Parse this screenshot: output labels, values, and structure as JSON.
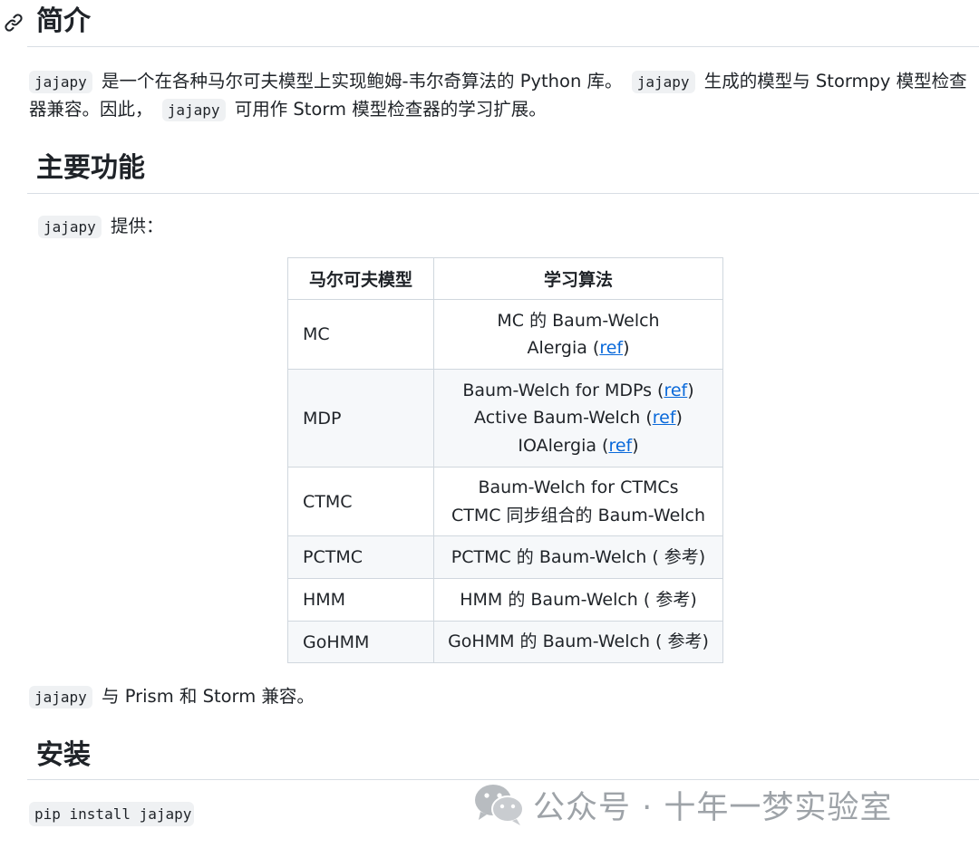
{
  "sections": {
    "intro_heading": "简介",
    "features_heading": "主要功能",
    "install_heading": "安装"
  },
  "intro": {
    "line1": {
      "code1": "jajapy",
      "text1": " 是一个在各种马尔可夫模型上实现鲍姆-韦尔奇算法的 Python 库。 ",
      "code2": "jajapy",
      "text2": " 生成的模型与 Stormpy 模型检查"
    },
    "line2": {
      "text1": "器兼容。因此， ",
      "code": "jajapy",
      "text2": " 可用作 Storm 模型检查器的学习扩展。"
    }
  },
  "provides": {
    "code": "jajapy",
    "text": " 提供："
  },
  "table": {
    "headers": [
      "马尔可夫模型",
      "学习算法"
    ],
    "rows": [
      {
        "model": "MC",
        "algos": [
          {
            "text": "MC 的 Baum-Welch",
            "ref": ""
          },
          {
            "text": "Alergia (",
            "ref": "ref",
            "after": ")"
          }
        ]
      },
      {
        "model": "MDP",
        "algos": [
          {
            "text": "Baum-Welch for MDPs (",
            "ref": "ref",
            "after": ")"
          },
          {
            "text": "Active Baum-Welch (",
            "ref": "ref",
            "after": ")"
          },
          {
            "text": "IOAlergia (",
            "ref": "ref",
            "after": ")"
          }
        ]
      },
      {
        "model": "CTMC",
        "algos": [
          {
            "text": "Baum-Welch for CTMCs",
            "ref": ""
          },
          {
            "text": "CTMC 同步组合的 Baum-Welch",
            "ref": ""
          }
        ]
      },
      {
        "model": "PCTMC",
        "algos": [
          {
            "text": "PCTMC 的 Baum-Welch ( 参考)",
            "ref": ""
          }
        ]
      },
      {
        "model": "HMM",
        "algos": [
          {
            "text": "HMM 的 Baum-Welch ( 参考)",
            "ref": ""
          }
        ]
      },
      {
        "model": "GoHMM",
        "algos": [
          {
            "text": "GoHMM 的 Baum-Welch ( 参考)",
            "ref": ""
          }
        ]
      }
    ]
  },
  "compat": {
    "code": "jajapy",
    "text": " 与 Prism 和 Storm 兼容。"
  },
  "install": {
    "command": "pip install jajapy"
  },
  "watermark": {
    "text": "公众号 · 十年一梦实验室"
  }
}
